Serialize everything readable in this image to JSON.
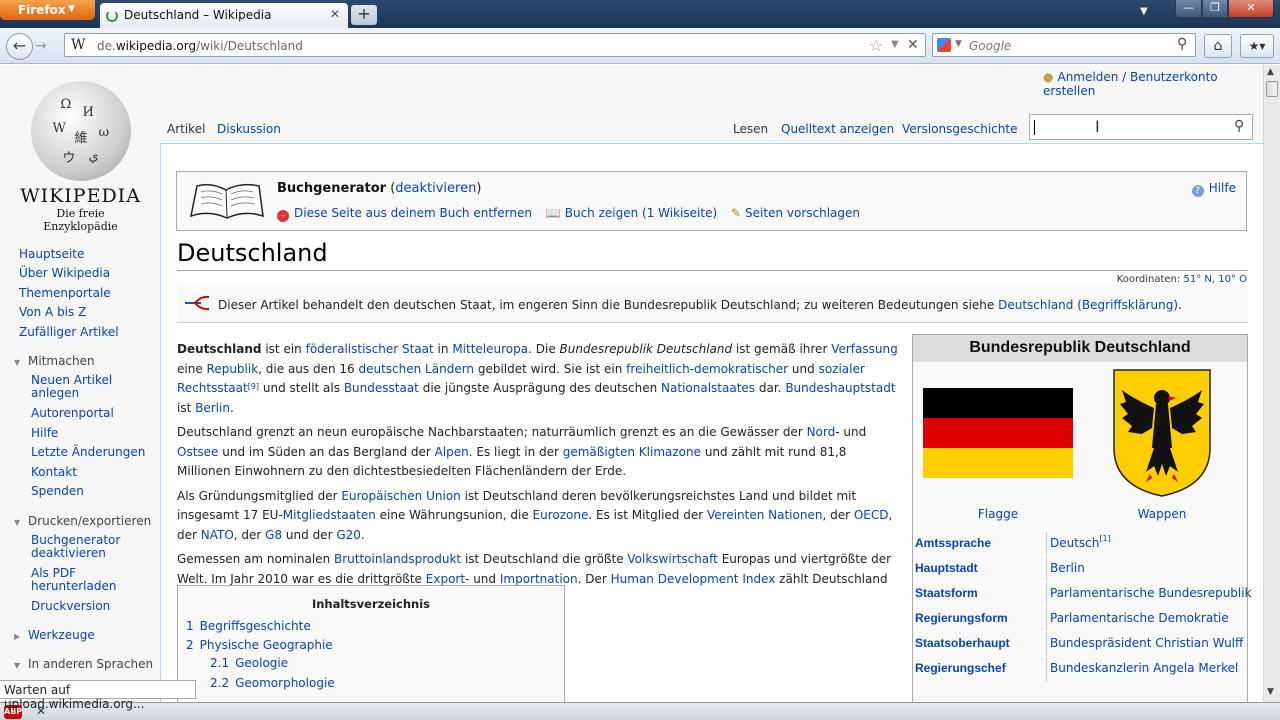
{
  "browser": {
    "app_button": "Firefox",
    "tab_title": "Deutschland – Wikipedia",
    "new_tab": "+",
    "url_prefix": "de.",
    "url_domain": "wikipedia.org",
    "url_path": "/wiki/Deutschland",
    "search_placeholder": "Google",
    "status_text": "Warten auf upload.wikimedia.org..."
  },
  "logo": {
    "wordmark": "WIKIPEDIA",
    "tagline": "Die freie Enzyklopädie"
  },
  "sidebar": {
    "main_links": [
      "Hauptseite",
      "Über Wikipedia",
      "Themenportale",
      "Von A bis Z",
      "Zufälliger Artikel"
    ],
    "mitmachen_heading": "Mitmachen",
    "mitmachen_links": [
      "Neuen Artikel anlegen",
      "Autorenportal",
      "Hilfe",
      "Letzte Änderungen",
      "Kontakt",
      "Spenden"
    ],
    "drucken_heading": "Drucken/exportieren",
    "drucken_links": [
      "Buchgenerator deaktivieren",
      "Als PDF herunterladen",
      "Druckversion"
    ],
    "werkzeuge_heading": "Werkzeuge",
    "sprachen_heading": "In anderen Sprachen"
  },
  "user": {
    "login": "Anmelden / Benutzerkonto erstellen"
  },
  "tabs": {
    "article": "Artikel",
    "discussion": "Diskussion",
    "read": "Lesen",
    "source": "Quelltext anzeigen",
    "history": "Versionsgeschichte"
  },
  "bookgen": {
    "title": "Buchgenerator",
    "deactivate": "deaktivieren",
    "remove": "Diese Seite aus deinem Buch entfernen",
    "show": "Buch zeigen (1 Wikiseite)",
    "suggest": "Seiten vorschlagen",
    "help": "Hilfe"
  },
  "article": {
    "title": "Deutschland",
    "coords_label": "Koordinaten:",
    "coords_value": "51° N, 10° O",
    "hatnote_text": "Dieser Artikel behandelt den deutschen Staat, im engeren Sinn die Bundesrepublik Deutschland; zu weiteren Bedeutungen siehe",
    "hatnote_link": "Deutschland (Begriffsklärung)"
  },
  "toc": {
    "title": "Inhaltsverzeichnis",
    "items": [
      {
        "num": "1",
        "label": "Begriffsgeschichte"
      },
      {
        "num": "2",
        "label": "Physische Geographie"
      },
      {
        "num": "2.1",
        "label": "Geologie"
      },
      {
        "num": "2.2",
        "label": "Geomorphologie"
      }
    ]
  },
  "infobox": {
    "title": "Bundesrepublik Deutschland",
    "flag_caption": "Flagge",
    "coat_caption": "Wappen",
    "flag_colors": [
      "#000000",
      "#dd0000",
      "#ffce00"
    ],
    "rows": [
      {
        "key": "Amtssprache",
        "value": "Deutsch",
        "ref": "[1]"
      },
      {
        "key": "Hauptstadt",
        "value": "Berlin",
        "ref": ""
      },
      {
        "key": "Staatsform",
        "value": "Parlamentarische Bundesrepublik",
        "ref": ""
      },
      {
        "key": "Regierungsform",
        "value": "Parlamentarische Demokratie",
        "ref": ""
      },
      {
        "key": "Staatsoberhaupt",
        "value": "Bundespräsident Christian Wulff",
        "ref": ""
      },
      {
        "key": "Regierungschef",
        "value": "Bundeskanzlerin Angela Merkel",
        "ref": ""
      }
    ]
  },
  "paragraphs": [
    [
      {
        "b": "Deutschland"
      },
      {
        "t": " ist ein "
      },
      {
        "a": "föderalistischer Staat"
      },
      {
        "t": " in "
      },
      {
        "a": "Mitteleuropa"
      },
      {
        "t": ". Die "
      },
      {
        "i": "Bundesrepublik Deutschland"
      },
      {
        "t": " ist gemäß ihrer "
      },
      {
        "a": "Verfassung"
      },
      {
        "t": " eine "
      },
      {
        "a": "Republik"
      },
      {
        "t": ", die aus den 16 "
      },
      {
        "a": "deutschen Ländern"
      },
      {
        "t": " gebildet wird. Sie ist ein "
      },
      {
        "a": "freiheitlich-demokratischer"
      },
      {
        "t": " und "
      },
      {
        "a": "sozialer Rechtsstaat"
      },
      {
        "sup": "[9]"
      },
      {
        "t": " und stellt als "
      },
      {
        "a": "Bundesstaat"
      },
      {
        "t": " die jüngste Ausprägung des deutschen "
      },
      {
        "a": "Nationalstaates"
      },
      {
        "t": " dar. "
      },
      {
        "a": "Bundeshauptstadt"
      },
      {
        "t": " ist "
      },
      {
        "a": "Berlin"
      },
      {
        "t": "."
      }
    ],
    [
      {
        "t": "Deutschland grenzt an neun europäische Nachbarstaaten; naturräumlich grenzt es an die Gewässer der "
      },
      {
        "a": "Nord"
      },
      {
        "t": "- und "
      },
      {
        "a": "Ostsee"
      },
      {
        "t": " und im Süden an das Bergland der "
      },
      {
        "a": "Alpen"
      },
      {
        "t": ". Es liegt in der "
      },
      {
        "a": "gemäßigten Klimazone"
      },
      {
        "t": " und zählt mit rund 81,8 Millionen Einwohnern zu den dichtestbesiedelten Flächenländern der Erde."
      }
    ],
    [
      {
        "t": "Als Gründungsmitglied der "
      },
      {
        "a": "Europäischen Union"
      },
      {
        "t": " ist Deutschland deren bevölkerungsreichstes Land und bildet mit insgesamt 17 EU-"
      },
      {
        "a": "Mitgliedstaaten"
      },
      {
        "t": " eine Währungsunion, die "
      },
      {
        "a": "Eurozone"
      },
      {
        "t": ". Es ist Mitglied der "
      },
      {
        "a": "Vereinten Nationen"
      },
      {
        "t": ", der "
      },
      {
        "a": "OECD"
      },
      {
        "t": ", der "
      },
      {
        "a": "NATO"
      },
      {
        "t": ", der "
      },
      {
        "a": "G8"
      },
      {
        "t": " und der "
      },
      {
        "a": "G20"
      },
      {
        "t": "."
      }
    ],
    [
      {
        "t": "Gemessen am nominalen "
      },
      {
        "a": "Bruttoinlandsprodukt"
      },
      {
        "t": " ist Deutschland die größte "
      },
      {
        "a": "Volkswirtschaft"
      },
      {
        "t": " Europas und viertgrößte der Welt. Im Jahr 2010 war es die drittgrößte "
      },
      {
        "a": "Export"
      },
      {
        "t": "- und "
      },
      {
        "a": "Importnation"
      },
      {
        "t": ". Der "
      },
      {
        "a": "Human Development Index"
      },
      {
        "t": " zählt Deutschland zu den sehr hoch entwickelten Staaten."
      }
    ]
  ]
}
